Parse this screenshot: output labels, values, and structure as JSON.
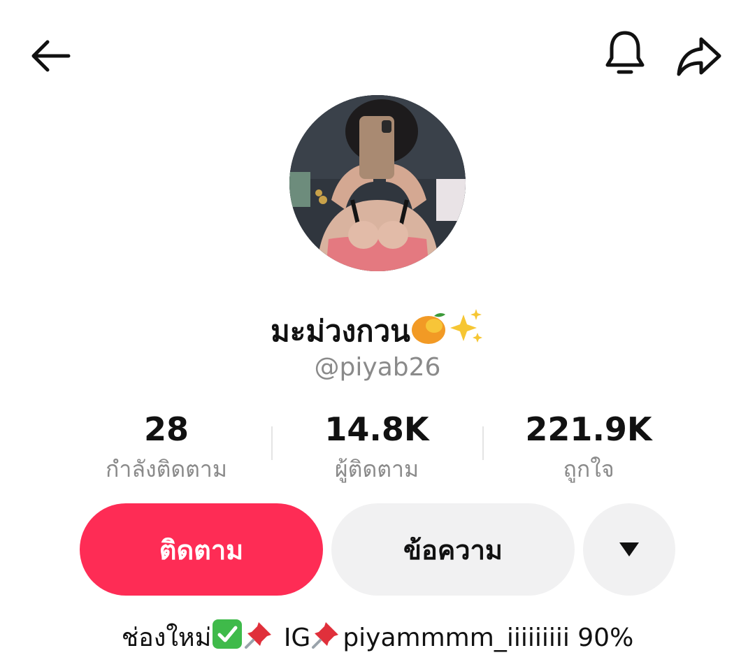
{
  "topbar": {
    "back_icon": "arrow-left-icon",
    "bell_icon": "bell-icon",
    "share_icon": "share-arrow-icon"
  },
  "profile": {
    "display_name": "มะม่วงกวน",
    "display_name_emojis": [
      "mango-emoji",
      "sparkles-emoji"
    ],
    "username": "@piyab26"
  },
  "stats": [
    {
      "value": "28",
      "label": "กำลังติดตาม"
    },
    {
      "value": "14.8K",
      "label": "ผู้ติดตาม"
    },
    {
      "value": "221.9K",
      "label": "ถูกใจ"
    }
  ],
  "actions": {
    "follow_label": "ติดตาม",
    "message_label": "ข้อความ",
    "more_icon": "triangle-down-icon"
  },
  "bio": {
    "part1": "ช่องใหม่",
    "part2": "IG",
    "part3": "piyammmm_iiiiiiiii 90%",
    "emojis": [
      "check-mark-emoji",
      "pushpin-emoji",
      "pushpin-emoji"
    ]
  },
  "colors": {
    "accent": "#fe2c55",
    "secondary_button": "#f1f1f2",
    "muted_text": "#8a8a8a"
  }
}
